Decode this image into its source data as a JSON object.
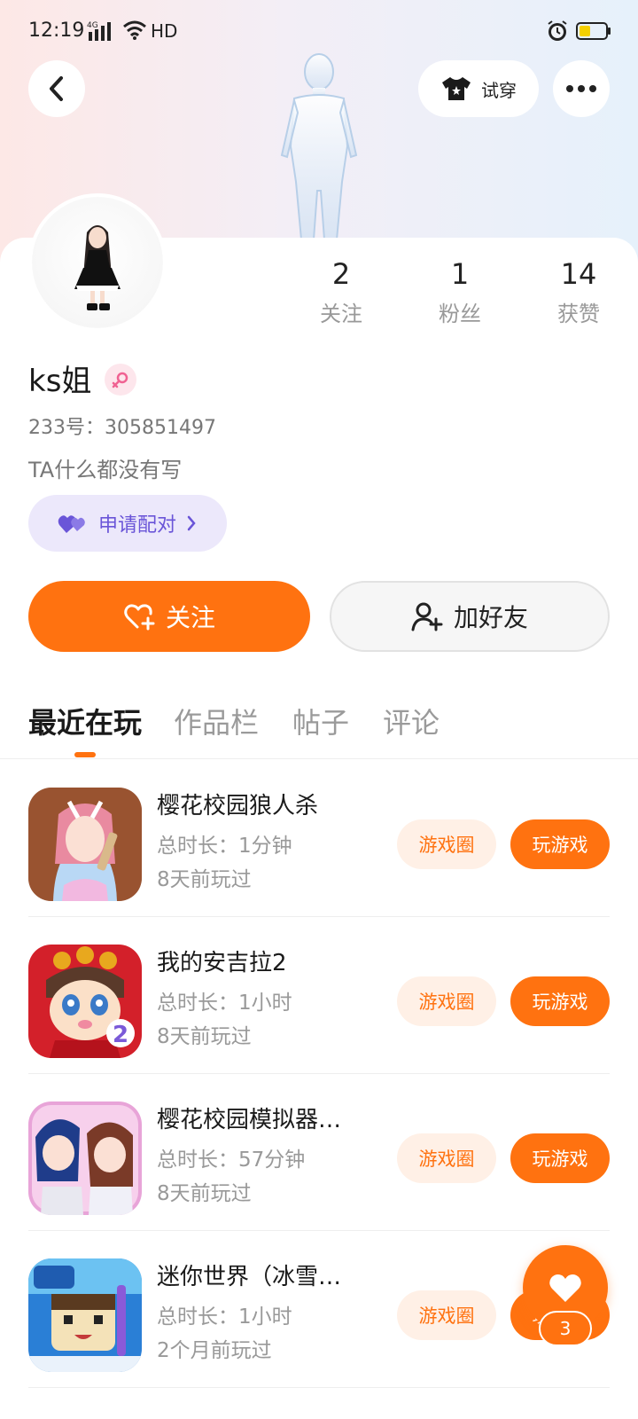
{
  "status_bar": {
    "time": "12:19",
    "network": "4G",
    "hd": "HD"
  },
  "header": {
    "try_on_label": "试穿"
  },
  "profile": {
    "name": "ks姐",
    "uid": "233号：305851497",
    "bio": "TA什么都没有写",
    "pair_label": "申请配对",
    "stats": [
      {
        "value": "2",
        "label": "关注"
      },
      {
        "value": "1",
        "label": "粉丝"
      },
      {
        "value": "14",
        "label": "获赞"
      }
    ]
  },
  "actions": {
    "follow_label": "关注",
    "add_friend_label": "加好友"
  },
  "tabs": [
    {
      "label": "最近在玩",
      "active": true
    },
    {
      "label": "作品栏",
      "active": false
    },
    {
      "label": "帖子",
      "active": false
    },
    {
      "label": "评论",
      "active": false
    }
  ],
  "games": [
    {
      "title": "樱花校园狼人杀",
      "duration": "总时长：1分钟",
      "last_played": "8天前玩过",
      "circle_label": "游戏圈",
      "play_label": "玩游戏"
    },
    {
      "title": "我的安吉拉2",
      "duration": "总时长：1小时",
      "last_played": "8天前玩过",
      "circle_label": "游戏圈",
      "play_label": "玩游戏"
    },
    {
      "title": "樱花校园模拟器…",
      "duration": "总时长：57分钟",
      "last_played": "8天前玩过",
      "circle_label": "游戏圈",
      "play_label": "玩游戏"
    },
    {
      "title": "迷你世界（冰雪…",
      "duration": "总时长：1小时",
      "last_played": "2个月前玩过",
      "circle_label": "游戏圈",
      "play_label": "玩游戏"
    }
  ],
  "like_fab": {
    "count": "3"
  },
  "colors": {
    "accent": "#ff7210",
    "accent_light": "#fff0e6",
    "pair_bg": "#ece8fb",
    "pair_text": "#6a55d8"
  }
}
